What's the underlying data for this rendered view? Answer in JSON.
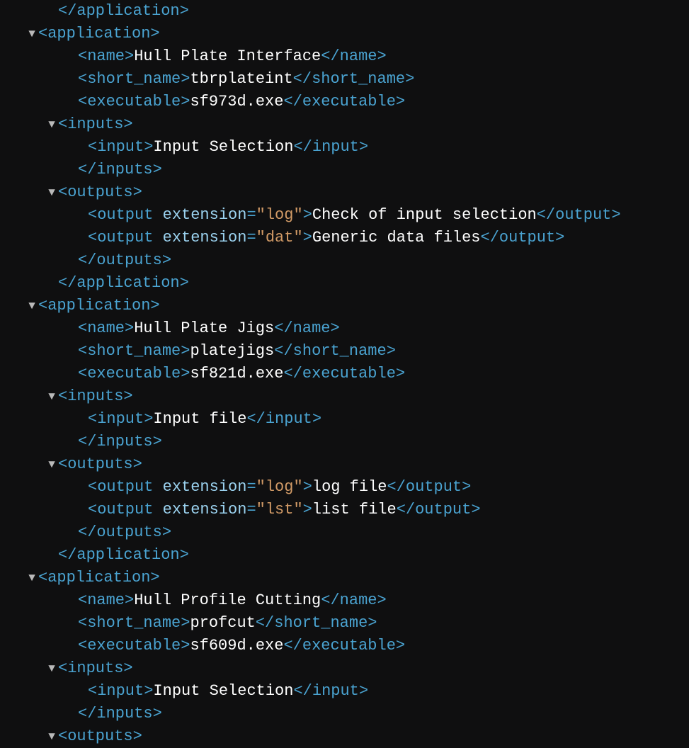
{
  "lines": [
    {
      "indent": 1,
      "toggle": false,
      "parts": [
        {
          "t": "tag",
          "v": "</application>"
        }
      ]
    },
    {
      "indent": 0,
      "toggle": true,
      "parts": [
        {
          "t": "tag",
          "v": "<application>"
        }
      ]
    },
    {
      "indent": 2,
      "toggle": false,
      "parts": [
        {
          "t": "tag",
          "v": "<name>"
        },
        {
          "t": "txt",
          "v": "Hull Plate Interface"
        },
        {
          "t": "tag",
          "v": "</name>"
        }
      ]
    },
    {
      "indent": 2,
      "toggle": false,
      "parts": [
        {
          "t": "tag",
          "v": "<short_name>"
        },
        {
          "t": "txt",
          "v": "tbrplateint"
        },
        {
          "t": "tag",
          "v": "</short_name>"
        }
      ]
    },
    {
      "indent": 2,
      "toggle": false,
      "parts": [
        {
          "t": "tag",
          "v": "<executable>"
        },
        {
          "t": "txt",
          "v": "sf973d.exe"
        },
        {
          "t": "tag",
          "v": "</executable>"
        }
      ]
    },
    {
      "indent": 1,
      "toggle": true,
      "parts": [
        {
          "t": "tag",
          "v": "<inputs>"
        }
      ]
    },
    {
      "indent": 3,
      "toggle": false,
      "parts": [
        {
          "t": "tag",
          "v": "<input>"
        },
        {
          "t": "txt",
          "v": "Input Selection"
        },
        {
          "t": "tag",
          "v": "</input>"
        }
      ]
    },
    {
      "indent": 2,
      "toggle": false,
      "parts": [
        {
          "t": "tag",
          "v": "</inputs>"
        }
      ]
    },
    {
      "indent": 1,
      "toggle": true,
      "parts": [
        {
          "t": "tag",
          "v": "<outputs>"
        }
      ]
    },
    {
      "indent": 3,
      "toggle": false,
      "parts": [
        {
          "t": "tag",
          "v": "<output "
        },
        {
          "t": "attr",
          "v": "extension"
        },
        {
          "t": "tag",
          "v": "="
        },
        {
          "t": "val",
          "v": "\"log\""
        },
        {
          "t": "tag",
          "v": ">"
        },
        {
          "t": "txt",
          "v": "Check of input selection"
        },
        {
          "t": "tag",
          "v": "</output>"
        }
      ]
    },
    {
      "indent": 3,
      "toggle": false,
      "parts": [
        {
          "t": "tag",
          "v": "<output "
        },
        {
          "t": "attr",
          "v": "extension"
        },
        {
          "t": "tag",
          "v": "="
        },
        {
          "t": "val",
          "v": "\"dat\""
        },
        {
          "t": "tag",
          "v": ">"
        },
        {
          "t": "txt",
          "v": "Generic data files"
        },
        {
          "t": "tag",
          "v": "</output>"
        }
      ]
    },
    {
      "indent": 2,
      "toggle": false,
      "parts": [
        {
          "t": "tag",
          "v": "</outputs>"
        }
      ]
    },
    {
      "indent": 1,
      "toggle": false,
      "parts": [
        {
          "t": "tag",
          "v": "</application>"
        }
      ]
    },
    {
      "indent": 0,
      "toggle": true,
      "parts": [
        {
          "t": "tag",
          "v": "<application>"
        }
      ]
    },
    {
      "indent": 2,
      "toggle": false,
      "parts": [
        {
          "t": "tag",
          "v": "<name>"
        },
        {
          "t": "txt",
          "v": "Hull Plate Jigs"
        },
        {
          "t": "tag",
          "v": "</name>"
        }
      ]
    },
    {
      "indent": 2,
      "toggle": false,
      "parts": [
        {
          "t": "tag",
          "v": "<short_name>"
        },
        {
          "t": "txt",
          "v": "platejigs"
        },
        {
          "t": "tag",
          "v": "</short_name>"
        }
      ]
    },
    {
      "indent": 2,
      "toggle": false,
      "parts": [
        {
          "t": "tag",
          "v": "<executable>"
        },
        {
          "t": "txt",
          "v": "sf821d.exe"
        },
        {
          "t": "tag",
          "v": "</executable>"
        }
      ]
    },
    {
      "indent": 1,
      "toggle": true,
      "parts": [
        {
          "t": "tag",
          "v": "<inputs>"
        }
      ]
    },
    {
      "indent": 3,
      "toggle": false,
      "parts": [
        {
          "t": "tag",
          "v": "<input>"
        },
        {
          "t": "txt",
          "v": "Input file"
        },
        {
          "t": "tag",
          "v": "</input>"
        }
      ]
    },
    {
      "indent": 2,
      "toggle": false,
      "parts": [
        {
          "t": "tag",
          "v": "</inputs>"
        }
      ]
    },
    {
      "indent": 1,
      "toggle": true,
      "parts": [
        {
          "t": "tag",
          "v": "<outputs>"
        }
      ]
    },
    {
      "indent": 3,
      "toggle": false,
      "parts": [
        {
          "t": "tag",
          "v": "<output "
        },
        {
          "t": "attr",
          "v": "extension"
        },
        {
          "t": "tag",
          "v": "="
        },
        {
          "t": "val",
          "v": "\"log\""
        },
        {
          "t": "tag",
          "v": ">"
        },
        {
          "t": "txt",
          "v": "log file"
        },
        {
          "t": "tag",
          "v": "</output>"
        }
      ]
    },
    {
      "indent": 3,
      "toggle": false,
      "parts": [
        {
          "t": "tag",
          "v": "<output "
        },
        {
          "t": "attr",
          "v": "extension"
        },
        {
          "t": "tag",
          "v": "="
        },
        {
          "t": "val",
          "v": "\"lst\""
        },
        {
          "t": "tag",
          "v": ">"
        },
        {
          "t": "txt",
          "v": "list file"
        },
        {
          "t": "tag",
          "v": "</output>"
        }
      ]
    },
    {
      "indent": 2,
      "toggle": false,
      "parts": [
        {
          "t": "tag",
          "v": "</outputs>"
        }
      ]
    },
    {
      "indent": 1,
      "toggle": false,
      "parts": [
        {
          "t": "tag",
          "v": "</application>"
        }
      ]
    },
    {
      "indent": 0,
      "toggle": true,
      "parts": [
        {
          "t": "tag",
          "v": "<application>"
        }
      ]
    },
    {
      "indent": 2,
      "toggle": false,
      "parts": [
        {
          "t": "tag",
          "v": "<name>"
        },
        {
          "t": "txt",
          "v": "Hull Profile Cutting"
        },
        {
          "t": "tag",
          "v": "</name>"
        }
      ]
    },
    {
      "indent": 2,
      "toggle": false,
      "parts": [
        {
          "t": "tag",
          "v": "<short_name>"
        },
        {
          "t": "txt",
          "v": "profcut"
        },
        {
          "t": "tag",
          "v": "</short_name>"
        }
      ]
    },
    {
      "indent": 2,
      "toggle": false,
      "parts": [
        {
          "t": "tag",
          "v": "<executable>"
        },
        {
          "t": "txt",
          "v": "sf609d.exe"
        },
        {
          "t": "tag",
          "v": "</executable>"
        }
      ]
    },
    {
      "indent": 1,
      "toggle": true,
      "parts": [
        {
          "t": "tag",
          "v": "<inputs>"
        }
      ]
    },
    {
      "indent": 3,
      "toggle": false,
      "parts": [
        {
          "t": "tag",
          "v": "<input>"
        },
        {
          "t": "txt",
          "v": "Input Selection"
        },
        {
          "t": "tag",
          "v": "</input>"
        }
      ]
    },
    {
      "indent": 2,
      "toggle": false,
      "parts": [
        {
          "t": "tag",
          "v": "</inputs>"
        }
      ]
    },
    {
      "indent": 1,
      "toggle": true,
      "parts": [
        {
          "t": "tag",
          "v": "<outputs>"
        }
      ]
    }
  ]
}
